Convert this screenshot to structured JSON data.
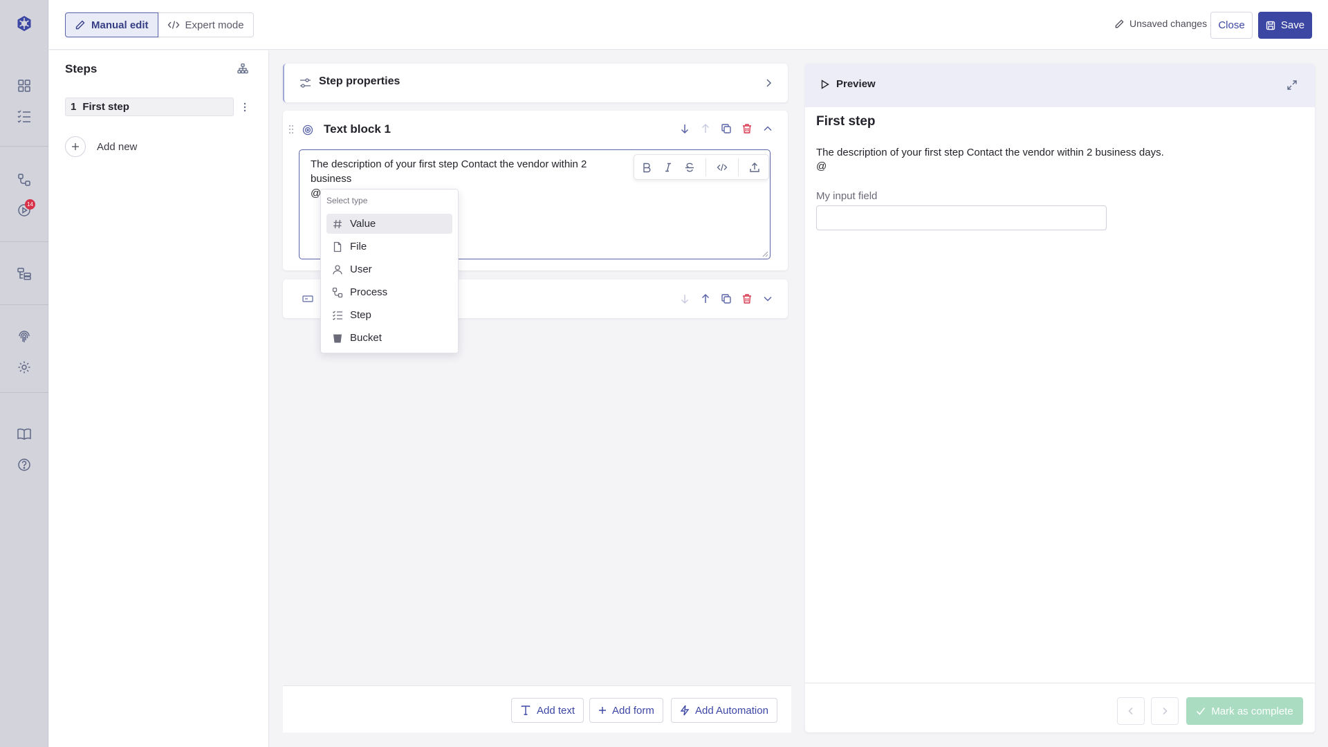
{
  "header": {
    "manual_edit": "Manual edit",
    "expert_mode": "Expert mode",
    "unsaved": "Unsaved changes",
    "close": "Close",
    "save": "Save"
  },
  "rail": {
    "badge_count": "14"
  },
  "steps_panel": {
    "title": "Steps",
    "items": [
      {
        "number": "1",
        "label": "First step"
      }
    ],
    "add_new": "Add new"
  },
  "editor": {
    "step_properties": "Step properties",
    "text_block": {
      "title": "Text block 1",
      "content": "The description of your first step Contact the vendor within 2 business\n@"
    },
    "dropdown": {
      "header": "Select type",
      "options": [
        "Value",
        "File",
        "User",
        "Process",
        "Step",
        "Bucket"
      ],
      "selected": "Value"
    },
    "bottom_actions": {
      "add_text": "Add text",
      "add_form": "Add form",
      "add_automation": "Add Automation"
    }
  },
  "preview": {
    "title": "Preview",
    "step_title": "First step",
    "description": "The description of your first step Contact the vendor within 2 business days.\n@",
    "input_label": "My input field",
    "mark_complete": "Mark as complete"
  },
  "colors": {
    "primary": "#3c46a3",
    "danger": "#d8324a",
    "success_disabled": "#a9dcc0",
    "rail_bg": "#d3d3dc"
  }
}
